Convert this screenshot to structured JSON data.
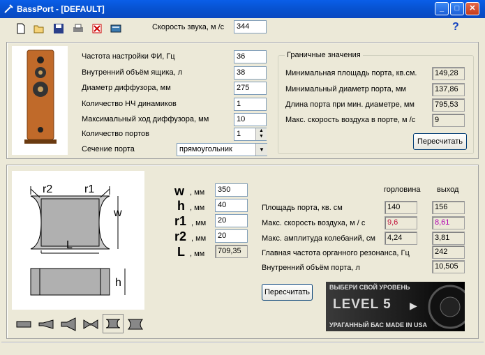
{
  "window": {
    "title": "BassPort - [DEFAULT]"
  },
  "toolbar": {
    "sound_speed_label": "Скорость звука, м /с",
    "sound_speed_value": "344",
    "help": "?"
  },
  "params": {
    "tuning_freq_label": "Частота настройки ФИ, Гц",
    "tuning_freq_value": "36",
    "box_volume_label": "Внутренний объём ящика, л",
    "box_volume_value": "38",
    "diffuser_diam_label": "Диаметр диффузора, мм",
    "diffuser_diam_value": "275",
    "drivers_count_label": "Количество НЧ динамиков",
    "drivers_count_value": "1",
    "max_excursion_label": "Максимальный ход диффузора, мм",
    "max_excursion_value": "10",
    "ports_count_label": "Количество портов",
    "ports_count_value": "1",
    "port_section_label": "Сечение порта",
    "port_section_value": "прямоугольник"
  },
  "limits": {
    "group_title": "Граничные значения",
    "min_area_label": "Минимальная площадь порта, кв.см.",
    "min_area_value": "149,28",
    "min_diam_label": "Минимальный диаметр порта, мм",
    "min_diam_value": "137,86",
    "port_len_label": "Длина порта при мин. диаметре, мм",
    "port_len_value": "795,53",
    "max_air_label": "Макс. скорость воздуха в порте, м /с",
    "max_air_value": "9",
    "recalc": "Пересчитать"
  },
  "diagram": {
    "r2": "r2",
    "r1": "r1",
    "w": "w",
    "L": "L",
    "h": "h"
  },
  "dims": [
    {
      "name": "w",
      "unit": ", мм",
      "value": "350"
    },
    {
      "name": "h",
      "unit": ", мм",
      "value": "40"
    },
    {
      "name": "r1",
      "unit": ", мм",
      "value": "20"
    },
    {
      "name": "r2",
      "unit": ", мм",
      "value": "20"
    },
    {
      "name": "L",
      "unit": ", мм",
      "value": "709,35"
    }
  ],
  "results": {
    "col_throat": "горловина",
    "col_exit": "выход",
    "area_label": "Площадь порта, кв. см",
    "area_throat": "140",
    "area_exit": "156",
    "air_speed_label": "Макс. скорость воздуха, м / с",
    "air_speed_throat": "9,6",
    "air_speed_exit": "8,61",
    "amplitude_label": "Макс. амплитуда колебаний, см",
    "amplitude_throat": "4,24",
    "amplitude_exit": "3,81",
    "organ_label": "Главная частота органного резонанса, Гц",
    "organ_value": "242",
    "port_vol_label": "Внутренний объём порта, л",
    "port_vol_value": "10,505",
    "recalc": "Пересчитать"
  },
  "banner": {
    "top": "ВЫБЕРИ СВОЙ УРОВЕНЬ",
    "main": "LEVEL 5",
    "bottom": "УРАГАННЫЙ БАС MADE IN USA"
  },
  "colors": {
    "throat_speed": "#c0103a",
    "exit_speed": "#b000b0"
  }
}
